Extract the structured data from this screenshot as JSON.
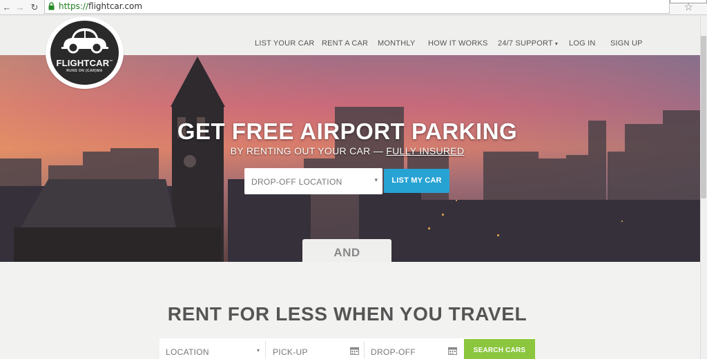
{
  "browser": {
    "back_glyph": "←",
    "forward_glyph": "→",
    "reload_glyph": "↻",
    "url_scheme": "https://",
    "url_host": "flightcar.com",
    "bookmark_icon": "star-icon"
  },
  "nav": {
    "items": [
      {
        "label": "LIST YOUR CAR"
      },
      {
        "label": "RENT A CAR"
      },
      {
        "label": "MONTHLY"
      },
      {
        "label": "HOW IT WORKS"
      },
      {
        "label": "24/7 SUPPORT"
      },
      {
        "label": "LOG IN"
      },
      {
        "label": "SIGN UP"
      }
    ],
    "support_caret": "▾"
  },
  "logo": {
    "wordmark": "FLIGHTCAR",
    "trademark": "™",
    "tagline": "RUNS ON (CAR)MA"
  },
  "hero": {
    "title": "GET FREE AIRPORT PARKING",
    "subtitle_prefix": "BY RENTING OUT YOUR CAR —",
    "subtitle_link": "FULLY INSURED",
    "dropoff_placeholder": "DROP-OFF LOCATION",
    "dropoff_caret": "▾",
    "list_button": "LIST MY CAR",
    "and_label": "AND"
  },
  "rent": {
    "title": "RENT FOR LESS WHEN YOU TRAVEL",
    "location_placeholder": "LOCATION",
    "location_caret": "▾",
    "pickup_placeholder": "PICK-UP",
    "dropoff_placeholder": "DROP-OFF",
    "search_button": "SEARCH CARS"
  },
  "colors": {
    "accent_blue": "#27a3d3",
    "accent_green": "#8cc63f",
    "text_dark": "#555555"
  }
}
